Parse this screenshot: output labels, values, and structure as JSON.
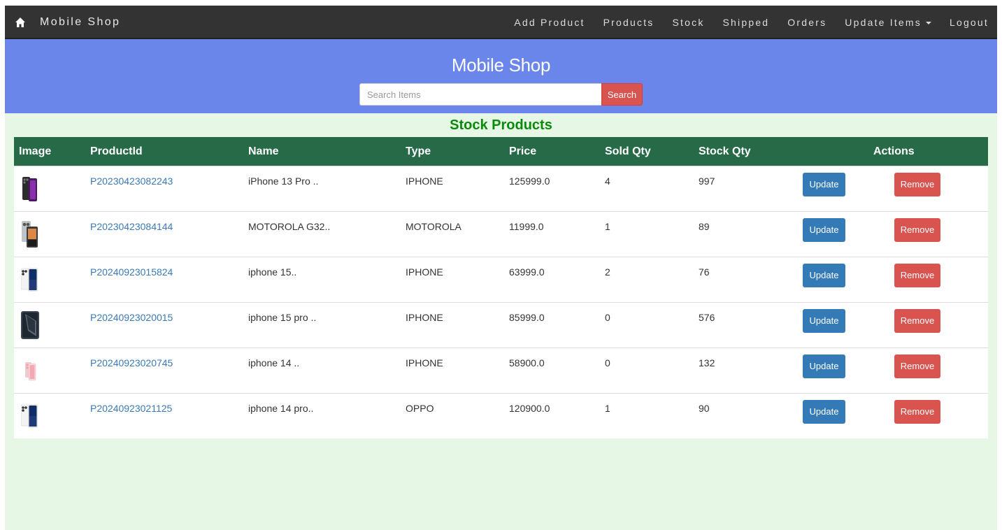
{
  "navbar": {
    "brand": "Mobile Shop",
    "home_icon": "home-icon",
    "links": [
      "Add Product",
      "Products",
      "Stock",
      "Shipped",
      "Orders",
      "Update Items",
      "Logout"
    ]
  },
  "hero": {
    "title": "Mobile Shop",
    "search_placeholder": "Search Items",
    "search_button": "Search"
  },
  "section_title": "Stock Products",
  "table": {
    "headers": [
      "Image",
      "ProductId",
      "Name",
      "Type",
      "Price",
      "Sold Qty",
      "Stock Qty",
      "Actions"
    ],
    "update_label": "Update",
    "remove_label": "Remove",
    "rows": [
      {
        "image": "iphone-13-pro-image",
        "product_id": "P20230423082243",
        "name": "iPhone 13 Pro ..",
        "type": "IPHONE",
        "price": "125999.0",
        "sold_qty": "4",
        "stock_qty": "997"
      },
      {
        "image": "motorola-g32-image",
        "product_id": "P20230423084144",
        "name": "MOTOROLA G32..",
        "type": "MOTOROLA",
        "price": "11999.0",
        "sold_qty": "1",
        "stock_qty": "89"
      },
      {
        "image": "iphone-15-image",
        "product_id": "P20240923015824",
        "name": "iphone 15..",
        "type": "IPHONE",
        "price": "63999.0",
        "sold_qty": "2",
        "stock_qty": "76"
      },
      {
        "image": "iphone-15-pro-image",
        "product_id": "P20240923020015",
        "name": "iphone 15 pro ..",
        "type": "IPHONE",
        "price": "85999.0",
        "sold_qty": "0",
        "stock_qty": "576"
      },
      {
        "image": "iphone-14-image",
        "product_id": "P20240923020745",
        "name": "iphone 14 ..",
        "type": "IPHONE",
        "price": "58900.0",
        "sold_qty": "0",
        "stock_qty": "132"
      },
      {
        "image": "iphone-14-pro-image",
        "product_id": "P20240923021125",
        "name": "iphone 14 pro..",
        "type": "OPPO",
        "price": "120900.0",
        "sold_qty": "1",
        "stock_qty": "90"
      }
    ]
  },
  "colors": {
    "navbar": "#333333",
    "hero": "#6b86ea",
    "page_bg": "#e6f7e6",
    "table_header": "#276a48",
    "title_green": "#0a8a0a",
    "link_blue": "#3b7ab5",
    "update_blue": "#337ab7",
    "remove_red": "#d9534f"
  }
}
